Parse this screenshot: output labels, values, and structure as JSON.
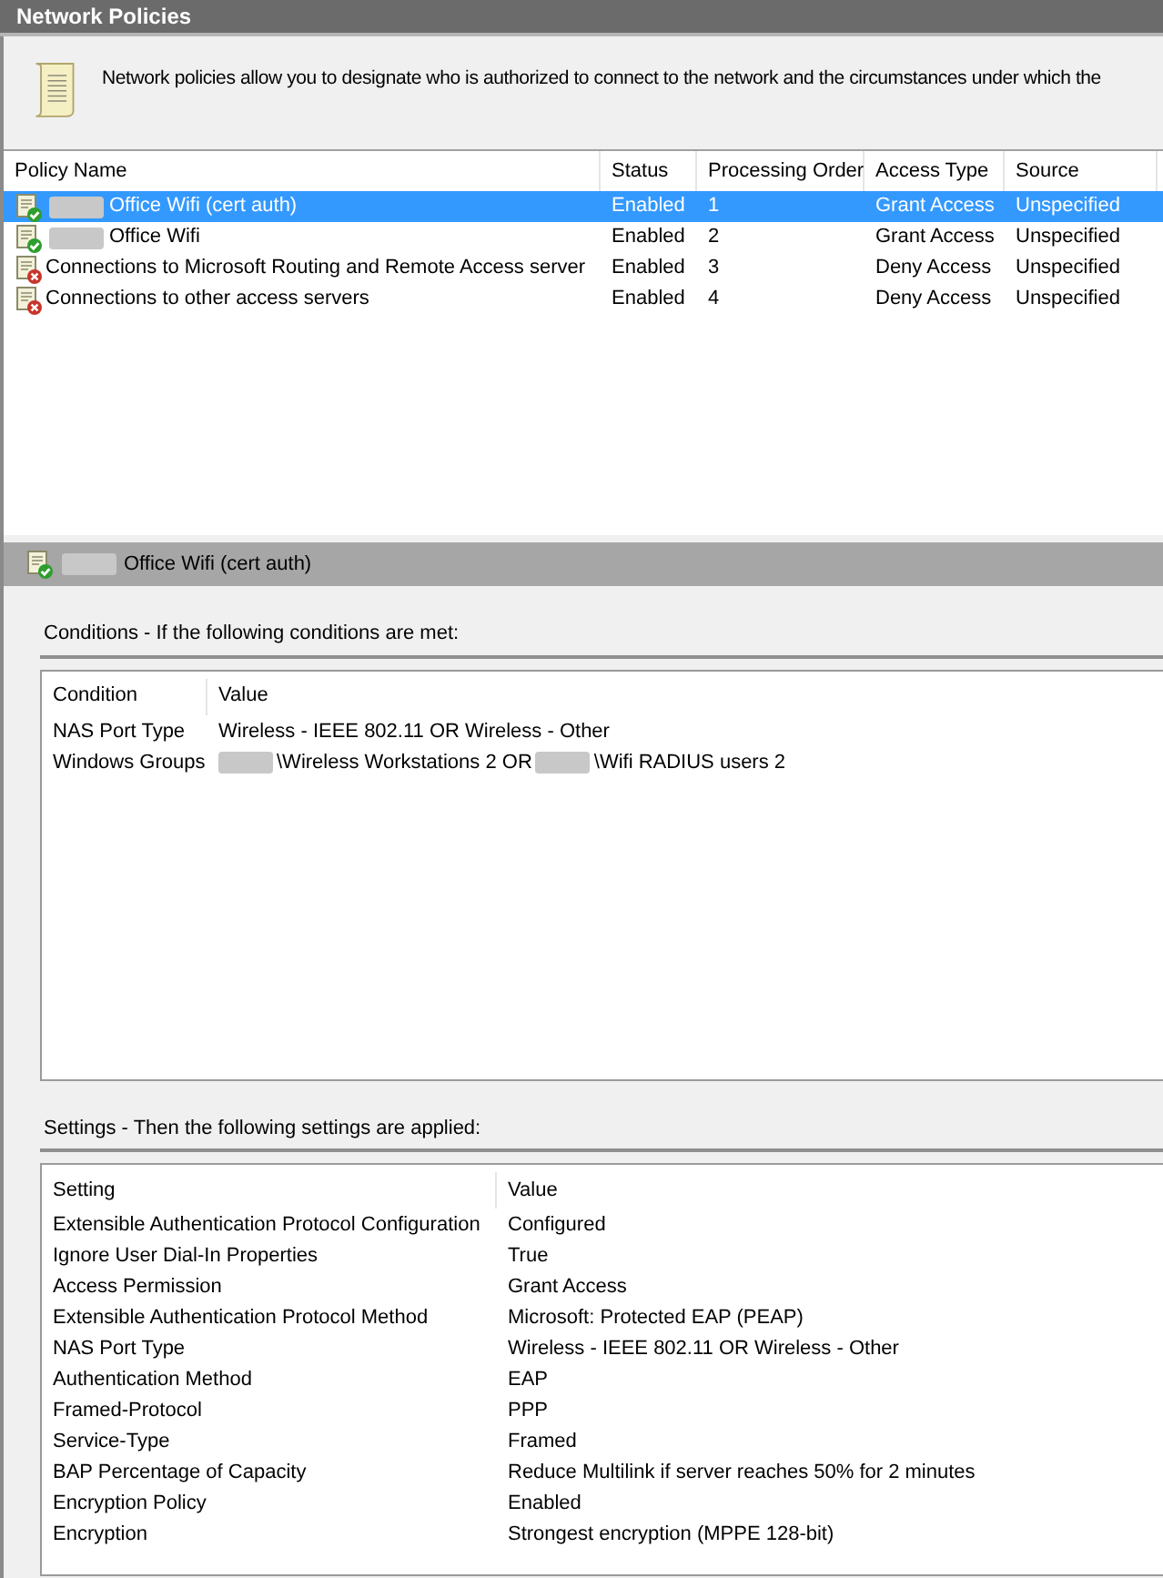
{
  "window": {
    "title": "Network Policies"
  },
  "description": "Network policies allow you to designate who is authorized to connect to the network and the circumstances under which the",
  "policies": {
    "columns": [
      "Policy Name",
      "Status",
      "Processing Order",
      "Access Type",
      "Source"
    ],
    "rows": [
      {
        "kind": "allow",
        "name_redacted": true,
        "name": "Office Wifi (cert auth)",
        "status": "Enabled",
        "order": "1",
        "access": "Grant Access",
        "source": "Unspecified",
        "selected": true
      },
      {
        "kind": "allow",
        "name_redacted": true,
        "name": "Office Wifi",
        "status": "Enabled",
        "order": "2",
        "access": "Grant Access",
        "source": "Unspecified",
        "selected": false
      },
      {
        "kind": "deny",
        "name_redacted": false,
        "name": "Connections to Microsoft Routing and Remote Access server",
        "status": "Enabled",
        "order": "3",
        "access": "Deny Access",
        "source": "Unspecified",
        "selected": false
      },
      {
        "kind": "deny",
        "name_redacted": false,
        "name": "Connections to other access servers",
        "status": "Enabled",
        "order": "4",
        "access": "Deny Access",
        "source": "Unspecified",
        "selected": false
      }
    ]
  },
  "detail": {
    "kind": "allow",
    "name_redacted": true,
    "name": "Office Wifi (cert auth)"
  },
  "conditions": {
    "heading": "Conditions - If the following conditions are met:",
    "columns": [
      "Condition",
      "Value"
    ],
    "rows": [
      {
        "name": "NAS Port Type",
        "value": [
          {
            "kind": "text",
            "text": "Wireless - IEEE 802.11 OR Wireless - Other"
          }
        ]
      },
      {
        "name": "Windows Groups",
        "value": [
          {
            "kind": "redacted"
          },
          {
            "kind": "text",
            "text": "\\Wireless Workstations 2 OR"
          },
          {
            "kind": "redacted"
          },
          {
            "kind": "text",
            "text": "\\Wifi RADIUS users 2"
          }
        ]
      }
    ]
  },
  "settings": {
    "heading": "Settings - Then the following settings are applied:",
    "columns": [
      "Setting",
      "Value"
    ],
    "rows": [
      {
        "name": "Extensible Authentication Protocol Configuration",
        "value": "Configured"
      },
      {
        "name": "Ignore User Dial-In Properties",
        "value": "True"
      },
      {
        "name": "Access Permission",
        "value": "Grant Access"
      },
      {
        "name": "Extensible Authentication Protocol Method",
        "value": "Microsoft: Protected EAP (PEAP)"
      },
      {
        "name": "NAS Port Type",
        "value": "Wireless - IEEE 802.11 OR Wireless - Other"
      },
      {
        "name": "Authentication Method",
        "value": "EAP"
      },
      {
        "name": "Framed-Protocol",
        "value": "PPP"
      },
      {
        "name": "Service-Type",
        "value": "Framed"
      },
      {
        "name": "BAP Percentage of Capacity",
        "value": "Reduce Multilink if server reaches 50% for 2 minutes"
      },
      {
        "name": "Encryption Policy",
        "value": "Enabled"
      },
      {
        "name": "Encryption",
        "value": "Strongest encryption (MPPE 128-bit)"
      }
    ]
  }
}
